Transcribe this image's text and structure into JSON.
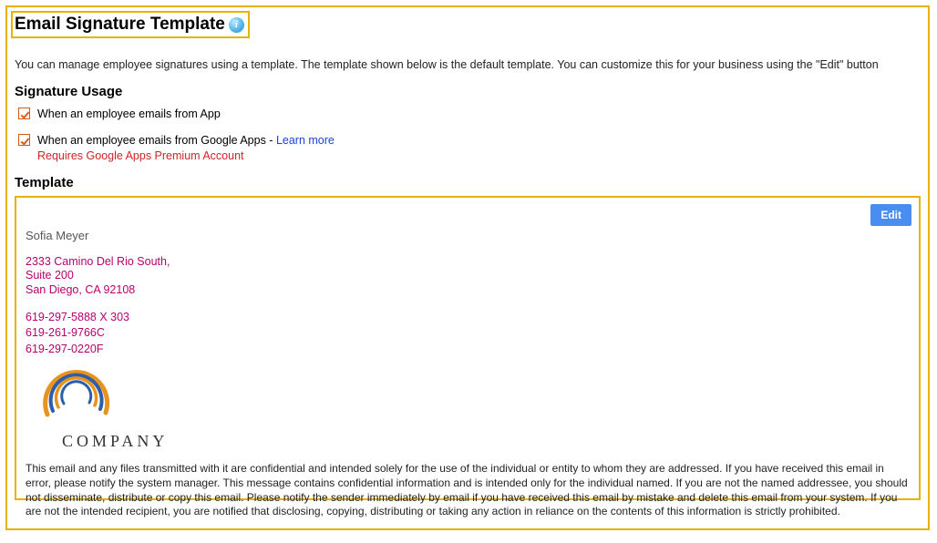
{
  "header": {
    "title": "Email Signature Template"
  },
  "intro": "You can manage employee signatures using a template. The template shown below is the default template. You can customize this for your business using the \"Edit\" button",
  "usage": {
    "heading": "Signature Usage",
    "items": [
      {
        "label": "When an employee emails from App"
      },
      {
        "label_prefix": "When an employee emails from Google Apps - ",
        "learn_more": "Learn more",
        "warning": "Requires Google Apps Premium Account"
      }
    ]
  },
  "template": {
    "heading": "Template",
    "edit_label": "Edit",
    "signature": {
      "name": "Sofia Meyer",
      "address_line1": "2333 Camino Del Rio South,",
      "address_line2": "Suite 200",
      "address_line3": "San Diego, CA 92108",
      "phone1": "619-297-5888 X 303",
      "phone2": "619-261-9766C",
      "phone3": "619-297-0220F",
      "company_text": "COMPANY",
      "disclaimer": "This email and any files transmitted with it are confidential and intended solely for the use of the individual or entity to whom they are addressed. If you have received this email in error, please notify the system manager. This message contains confidential information and is intended only for the individual named. If you are not the named addressee, you should not disseminate, distribute or copy this email. Please notify the sender immediately by email if you have received this email by mistake and delete this email from your system. If you are not the intended recipient, you are notified that disclosing, copying, distributing or taking any action in reliance on the contents of this information is strictly prohibited."
    }
  }
}
